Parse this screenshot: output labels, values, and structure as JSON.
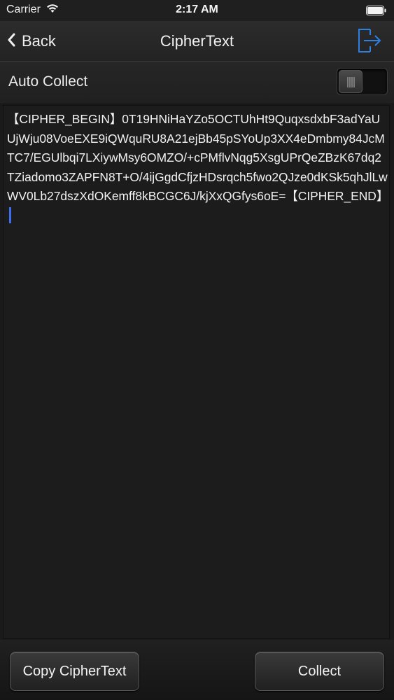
{
  "status_bar": {
    "carrier": "Carrier",
    "time": "2:17 AM",
    "icons": [
      "wifi-icon",
      "battery-icon"
    ]
  },
  "nav": {
    "back_label": "Back",
    "title": "CipherText",
    "right_icon": "export-icon",
    "accent_color": "#2f7fe0"
  },
  "auto_collect": {
    "label": "Auto Collect",
    "enabled": false
  },
  "cipher": {
    "text": "【CIPHER_BEGIN】0T19HNiHaYZo5OCTUhHt9QuqxsdxbF3adYaUUjWju08VoeEXE9iQWquRU8A21ejBb45pSYoUp3XX4eDmbmy84JcMTC7/EGUlbqi7LXiywMsy6OMZO/+cPMflvNqg5XsgUPrQeZBzK67dq2TZiadomo3ZAPFN8T+O/4ijGgdCfjzHDsrqch5fwo2QJze0dKSk5qhJlLwWV0Lb27dszXdOKemff8kBCGC6J/kjXxQGfys6oE=【CIPHER_END】",
    "caret_color": "#3d6cf0"
  },
  "actions": {
    "copy_label": "Copy CipherText",
    "collect_label": "Collect"
  }
}
